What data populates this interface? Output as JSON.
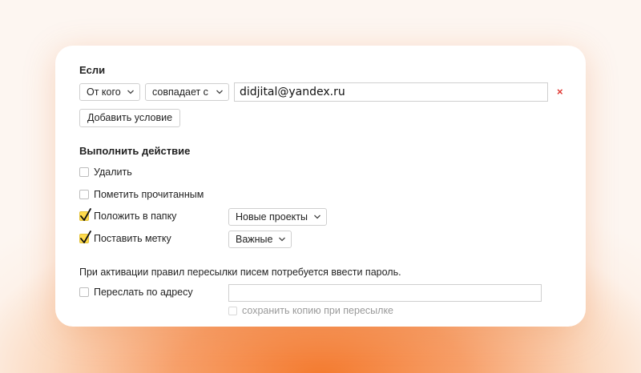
{
  "condition": {
    "title": "Если",
    "field_select": "От кого",
    "operator_select": "совпадает с",
    "value": "didjital@yandex.ru",
    "remove_icon": "×",
    "add_condition_label": "Добавить условие"
  },
  "actions": {
    "title": "Выполнить действие",
    "items": [
      {
        "label": "Удалить",
        "checked": false
      },
      {
        "label": "Пометить прочитанным",
        "checked": false
      },
      {
        "label": "Положить в папку",
        "checked": true,
        "select": "Новые проекты"
      },
      {
        "label": "Поставить метку",
        "checked": true,
        "select": "Важные"
      }
    ]
  },
  "forward": {
    "info": "При активации правил пересылки писем потребуется ввести пароль.",
    "label": "Переслать по адресу",
    "checked": false,
    "address": "",
    "keep_copy_label": "сохранить копию при пересылке"
  },
  "colors": {
    "accent_check": "#ffdb4d",
    "remove": "#e0342f",
    "background_glow": "#f47a2e"
  },
  "icons": {
    "chevron": "chevron-down-icon",
    "remove": "close-icon",
    "check": "checkmark-icon"
  }
}
